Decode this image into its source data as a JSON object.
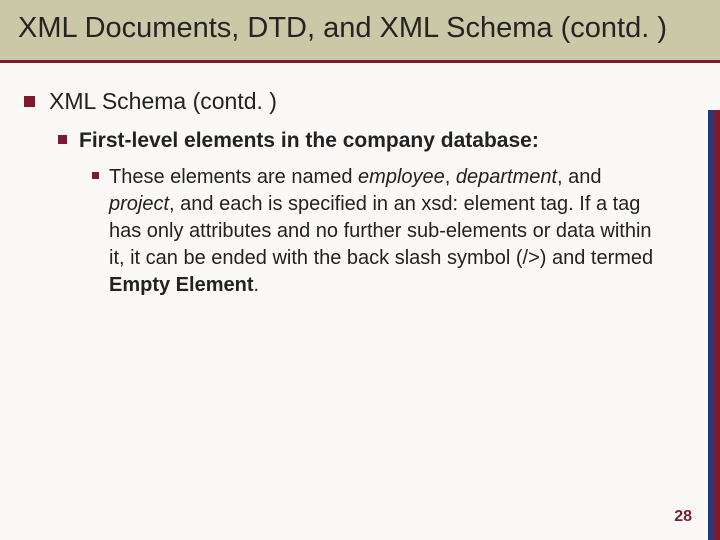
{
  "title": "XML Documents, DTD, and XML Schema (contd. )",
  "body": {
    "level1": "XML Schema (contd. )",
    "level2": "First-level elements in the company database:",
    "level3": {
      "pre": "These elements are named ",
      "em1": "employee",
      "sep1": ", ",
      "em2": "department",
      "sep2": ", and ",
      "em3": "project",
      "mid": ", and each is specified in an xsd: element tag. If a tag has only attributes and no further sub-elements or data within it, it can be ended with the back slash symbol (/>) and termed ",
      "strong": "Empty Element",
      "post": "."
    }
  },
  "page_number": "28"
}
